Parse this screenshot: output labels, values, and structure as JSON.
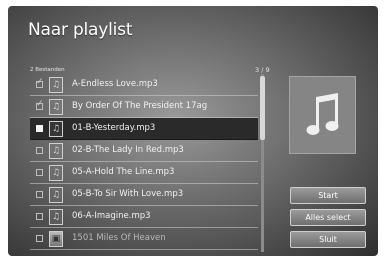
{
  "header": {
    "title": "Naar playlist"
  },
  "list": {
    "count_label": "2 Bestanden",
    "page_label": "3 / 9",
    "items": [
      {
        "name": "A-Endless Love.mp3",
        "checked": true,
        "icon": "music-file-icon"
      },
      {
        "name": "By Order Of The President 17ag",
        "checked": true,
        "icon": "music-file-icon"
      },
      {
        "name": "01-B-Yesterday.mp3",
        "checked": false,
        "icon": "music-file-icon"
      },
      {
        "name": "02-B-The Lady In Red.mp3",
        "checked": false,
        "icon": "music-file-icon"
      },
      {
        "name": "05-A-Hold The Line.mp3",
        "checked": false,
        "icon": "music-file-icon"
      },
      {
        "name": "05-B-To Sir With Love.mp3",
        "checked": false,
        "icon": "music-file-icon"
      },
      {
        "name": "06-A-Imagine.mp3",
        "checked": false,
        "icon": "music-file-icon"
      },
      {
        "name": "1501 Miles Of Heaven",
        "checked": false,
        "icon": "photo-thumbnail-icon"
      }
    ]
  },
  "preview": {
    "icon": "music-note-icon"
  },
  "buttons": {
    "start": "Start",
    "select_all": "Alles select",
    "close": "Sluit"
  }
}
